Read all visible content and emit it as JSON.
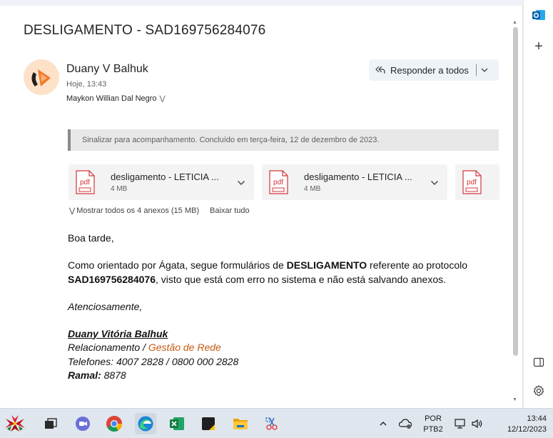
{
  "email": {
    "subject": "DESLIGAMENTO - SAD169756284076",
    "sender": "Duany V Balhuk",
    "time": "Hoje, 13:43",
    "recipient": "Maykon Willian Dal Negro",
    "reply_all_label": "Responder a todos",
    "flag_text": "Sinalizar para acompanhamento. Concluído em terça-feira, 12 de dezembro de 2023.",
    "attachments": [
      {
        "name": "desligamento - LETICIA ...",
        "size": "4 MB"
      },
      {
        "name": "desligamento - LETICIA ...",
        "size": "4 MB"
      },
      {
        "name": "",
        "size": ""
      }
    ],
    "show_all_label": "Mostrar todos os 4 anexos (15 MB)",
    "download_all_label": "Baixar tudo",
    "body": {
      "greeting": "Boa tarde,",
      "p1_a": "Como orientado por Ágata, segue formulários de ",
      "p1_b": "DESLIGAMENTO",
      "p1_c": " referente ao protocolo ",
      "p1_d": "SAD169756284076",
      "p1_e": ", visto que está com erro no sistema e não está salvando anexos.",
      "closing": "Atenciosamente,",
      "sig_name": "Duany Vitória Balhuk ",
      "sig_dept_a": "Relacionamento / ",
      "sig_dept_b": "Gestão de Rede",
      "sig_phones": "Telefones: 4007 2828 / 0800 000 2828",
      "sig_ramal_label": "Ramal:",
      "sig_ramal_value": " 8878"
    }
  },
  "taskbar": {
    "lang_1": "POR",
    "lang_2": "PTB2",
    "clock_time": "13:44",
    "clock_date": "12/12/2023"
  },
  "colors": {
    "accent_blue": "#0f6cbd",
    "orange_link": "#c55a11",
    "pdf_red": "#d13438"
  }
}
